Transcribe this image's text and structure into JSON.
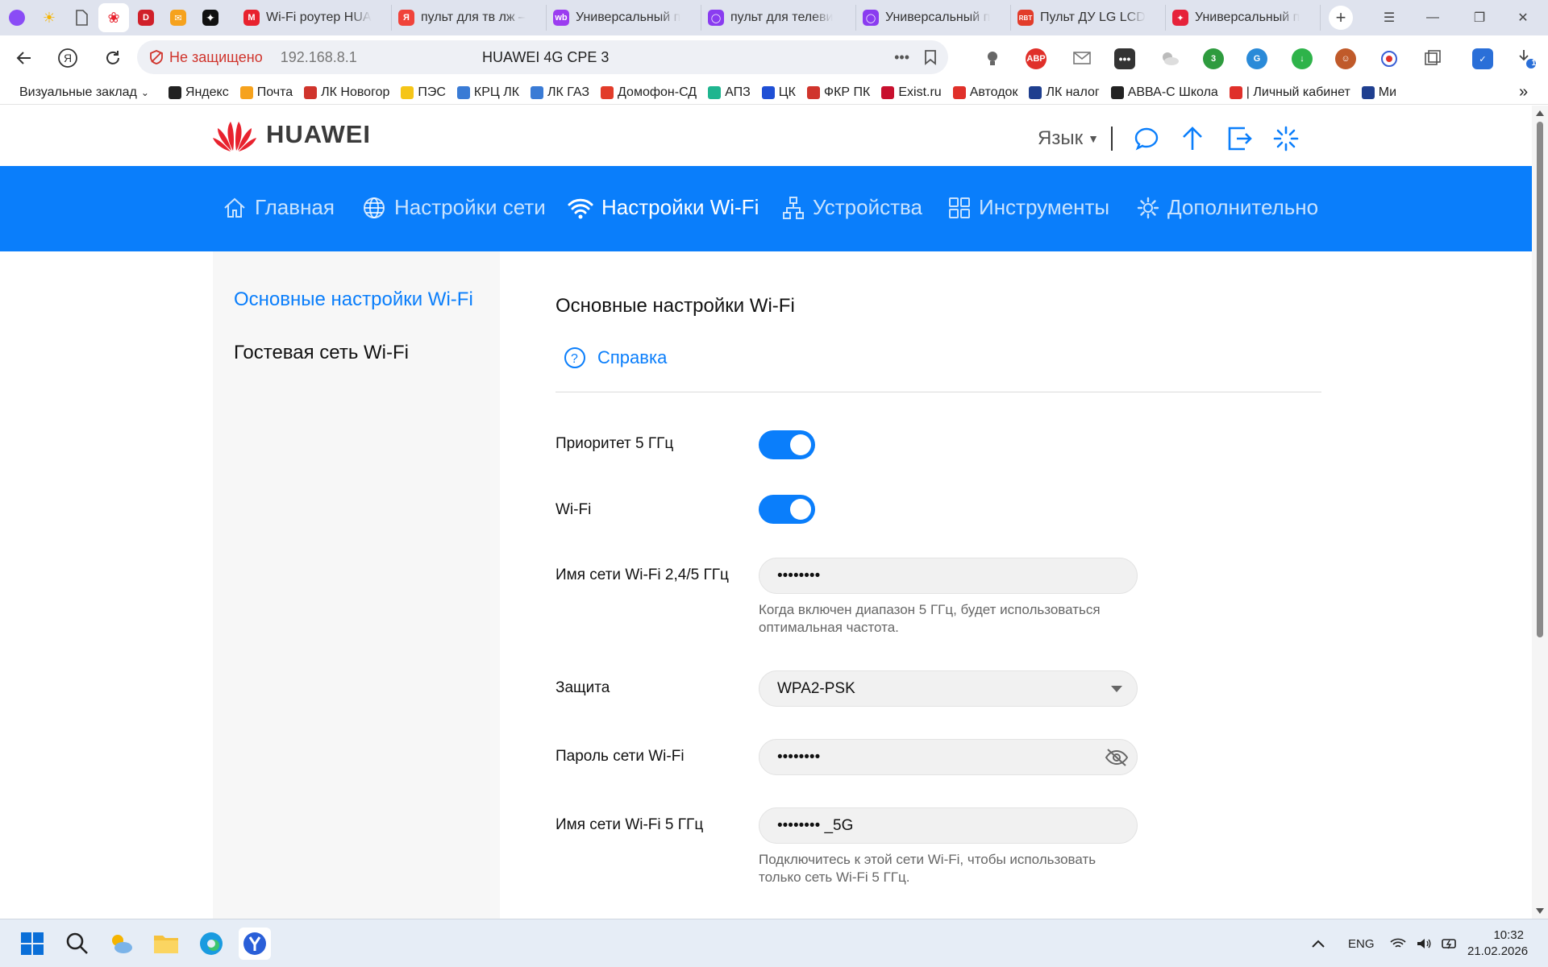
{
  "browser": {
    "pinned_tabs": [
      "Алиса",
      "Погода",
      "Документ",
      "Huawei",
      "Дзен",
      "Почта",
      "Нейро"
    ],
    "tabs": [
      {
        "label": "Wi-Fi роутер HUA",
        "color": "#e8222e",
        "mark": "M"
      },
      {
        "label": "пульт для тв лж –",
        "color": "#f0433a",
        "mark": "Я"
      },
      {
        "label": "Универсальный п",
        "color": "#9b3cf0",
        "mark": "wb"
      },
      {
        "label": "пульт для телеви",
        "color": "#8a3cf0",
        "mark": "◯"
      },
      {
        "label": "Универсальный п",
        "color": "#8a3cf0",
        "mark": "◯"
      },
      {
        "label": "Пульт ДУ LG LCD",
        "color": "#e23c2a",
        "mark": "RBT"
      },
      {
        "label": "Универсальный п",
        "color": "#e6223a",
        "mark": "✦"
      }
    ],
    "new_tab": "+",
    "security_label": "Не защищено",
    "url": "192.168.8.1",
    "page_title": "HUAWEI 4G CPE 3",
    "extensions": [
      "ABP",
      "3",
      "1"
    ],
    "bookmarks_toggle": "Визуальные заклад",
    "bookmarks": [
      {
        "label": "Яндекс",
        "color": "#222"
      },
      {
        "label": "Почта",
        "color": "#f6a21d"
      },
      {
        "label": "ЛК Новогор",
        "color": "#d0342c"
      },
      {
        "label": "ПЭС",
        "color": "#f5c518"
      },
      {
        "label": "КРЦ ЛК",
        "color": "#3a7bd5"
      },
      {
        "label": "ЛК ГАЗ",
        "color": "#3a7bd5"
      },
      {
        "label": "Домофон-СД",
        "color": "#e23c2a"
      },
      {
        "label": "АПЗ",
        "color": "#1fb58f"
      },
      {
        "label": "ЦК",
        "color": "#1f4fd5"
      },
      {
        "label": "ФКР ПК",
        "color": "#d0342c"
      },
      {
        "label": "Exist.ru",
        "color": "#c8102e"
      },
      {
        "label": "Автодок",
        "color": "#e0302a"
      },
      {
        "label": "ЛК налог",
        "color": "#1f3f8f"
      },
      {
        "label": "АВВА-С Школа",
        "color": "#222"
      },
      {
        "label": "| Личный кабинет",
        "color": "#e0302a"
      },
      {
        "label": "Ми",
        "color": "#1f3f8f"
      }
    ],
    "bookmarks_more": "»"
  },
  "header": {
    "brand": "HUAWEI",
    "language": "Язык"
  },
  "nav": {
    "items": [
      {
        "label": "Главная",
        "icon": "home-icon"
      },
      {
        "label": "Настройки сети",
        "icon": "globe-icon"
      },
      {
        "label": "Настройки Wi-Fi",
        "icon": "wifi-icon",
        "active": true
      },
      {
        "label": "Устройства",
        "icon": "devices-icon"
      },
      {
        "label": "Инструменты",
        "icon": "tools-icon"
      },
      {
        "label": "Дополнительно",
        "icon": "gear-icon"
      }
    ]
  },
  "sidebar": {
    "items": [
      {
        "label": "Основные настройки Wi-Fi",
        "active": true
      },
      {
        "label": "Гостевая сеть Wi-Fi",
        "active": false
      }
    ]
  },
  "content": {
    "title": "Основные настройки Wi-Fi",
    "help": "Справка",
    "priority_5g": {
      "label": "Приоритет 5 ГГц",
      "on": true
    },
    "wifi": {
      "label": "Wi-Fi",
      "on": true
    },
    "ssid_24_5": {
      "label": "Имя сети Wi-Fi 2,4/5 ГГц",
      "value": "••••••••",
      "hint": "Когда включен диапазон 5 ГГц, будет использоваться оптимальная частота."
    },
    "security": {
      "label": "Защита",
      "value": "WPA2-PSK"
    },
    "password": {
      "label": "Пароль сети Wi-Fi",
      "value": "••••••••"
    },
    "ssid_5": {
      "label": "Имя сети Wi-Fi 5 ГГц",
      "value": "•••••••• _5G",
      "hint": "Подключитесь к этой сети Wi-Fi, чтобы использовать только сеть Wi-Fi 5 ГГц."
    }
  },
  "colors": {
    "accent": "#0a7efb",
    "security_warning": "#d0342c"
  },
  "taskbar": {
    "language": "ENG",
    "time": "10:32",
    "date": "21.02.2026"
  }
}
